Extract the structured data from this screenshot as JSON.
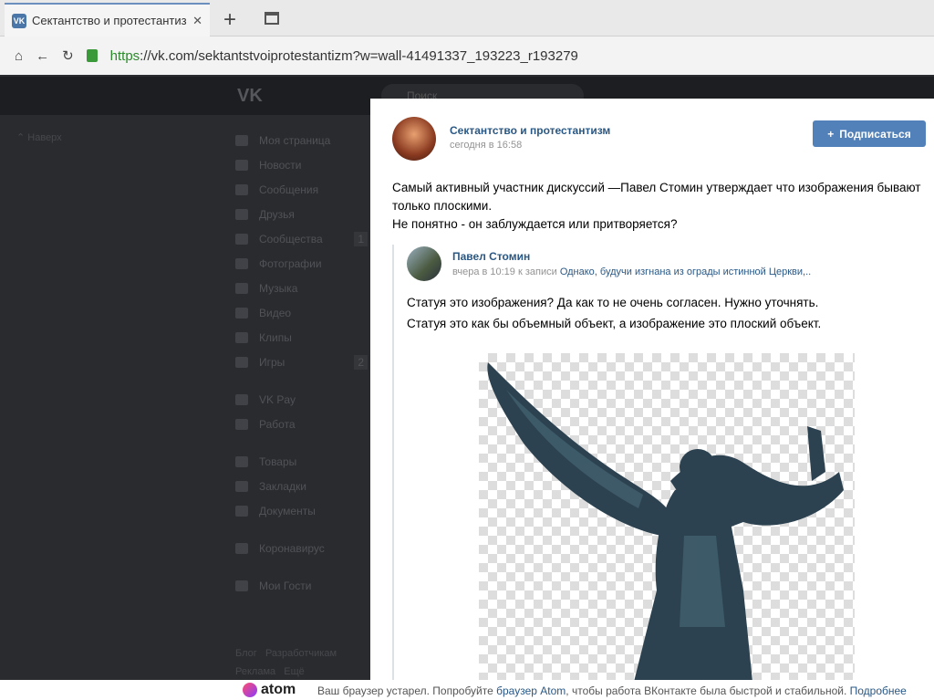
{
  "browser": {
    "tab_title": "Сектантство и протестантизм",
    "url_scheme": "https",
    "url_rest": "://vk.com/sektantstvoiprotestantizm?w=wall-41491337_193223_r193279"
  },
  "vk": {
    "logo": "VK",
    "search_placeholder": "Поиск",
    "back_to_top": "Наверх",
    "menu": [
      {
        "label": "Моя страница"
      },
      {
        "label": "Новости"
      },
      {
        "label": "Сообщения"
      },
      {
        "label": "Друзья"
      },
      {
        "label": "Сообщества",
        "count": "1"
      },
      {
        "label": "Фотографии"
      },
      {
        "label": "Музыка"
      },
      {
        "label": "Видео"
      },
      {
        "label": "Клипы"
      },
      {
        "label": "Игры",
        "count": "2"
      },
      {
        "label": "VK Pay",
        "gap": true
      },
      {
        "label": "Работа"
      },
      {
        "label": "Товары",
        "gap": true
      },
      {
        "label": "Закладки"
      },
      {
        "label": "Документы"
      },
      {
        "label": "Коронавирус",
        "gap": true
      },
      {
        "label": "Мои Гости",
        "gap": true
      }
    ],
    "footer": [
      "Блог",
      "Разработчикам",
      "Реклама",
      "Ещё"
    ]
  },
  "post": {
    "group": "Сектантство и протестантизм",
    "time": "сегодня в 16:58",
    "subscribe": "Подписаться",
    "text": [
      "Самый активный участник дискуссий —Павел Стомин утверждает что изображения бывают только плоскими.",
      "Не понятно - он заблуждается или притворяется?"
    ],
    "repost": {
      "author": "Павел Стомин",
      "meta": "вчера в 10:19 к записи",
      "link": "Однако, будучи изгнана из ограды истинной Церкви,..",
      "lines": [
        "Статуя это изображения? Да как то не очень согласен. Нужно уточнять.",
        "Статуя это как бы объемный объект, а изображение это плоский объект."
      ]
    }
  },
  "atom": {
    "logo": "atom",
    "msg": "Ваш браузер устарел. Попробуйте ",
    "link1": "браузер Atom",
    "msg2": ", чтобы работа ВКонтакте была быстрой и стабильной. ",
    "link2": "Подробнее"
  }
}
